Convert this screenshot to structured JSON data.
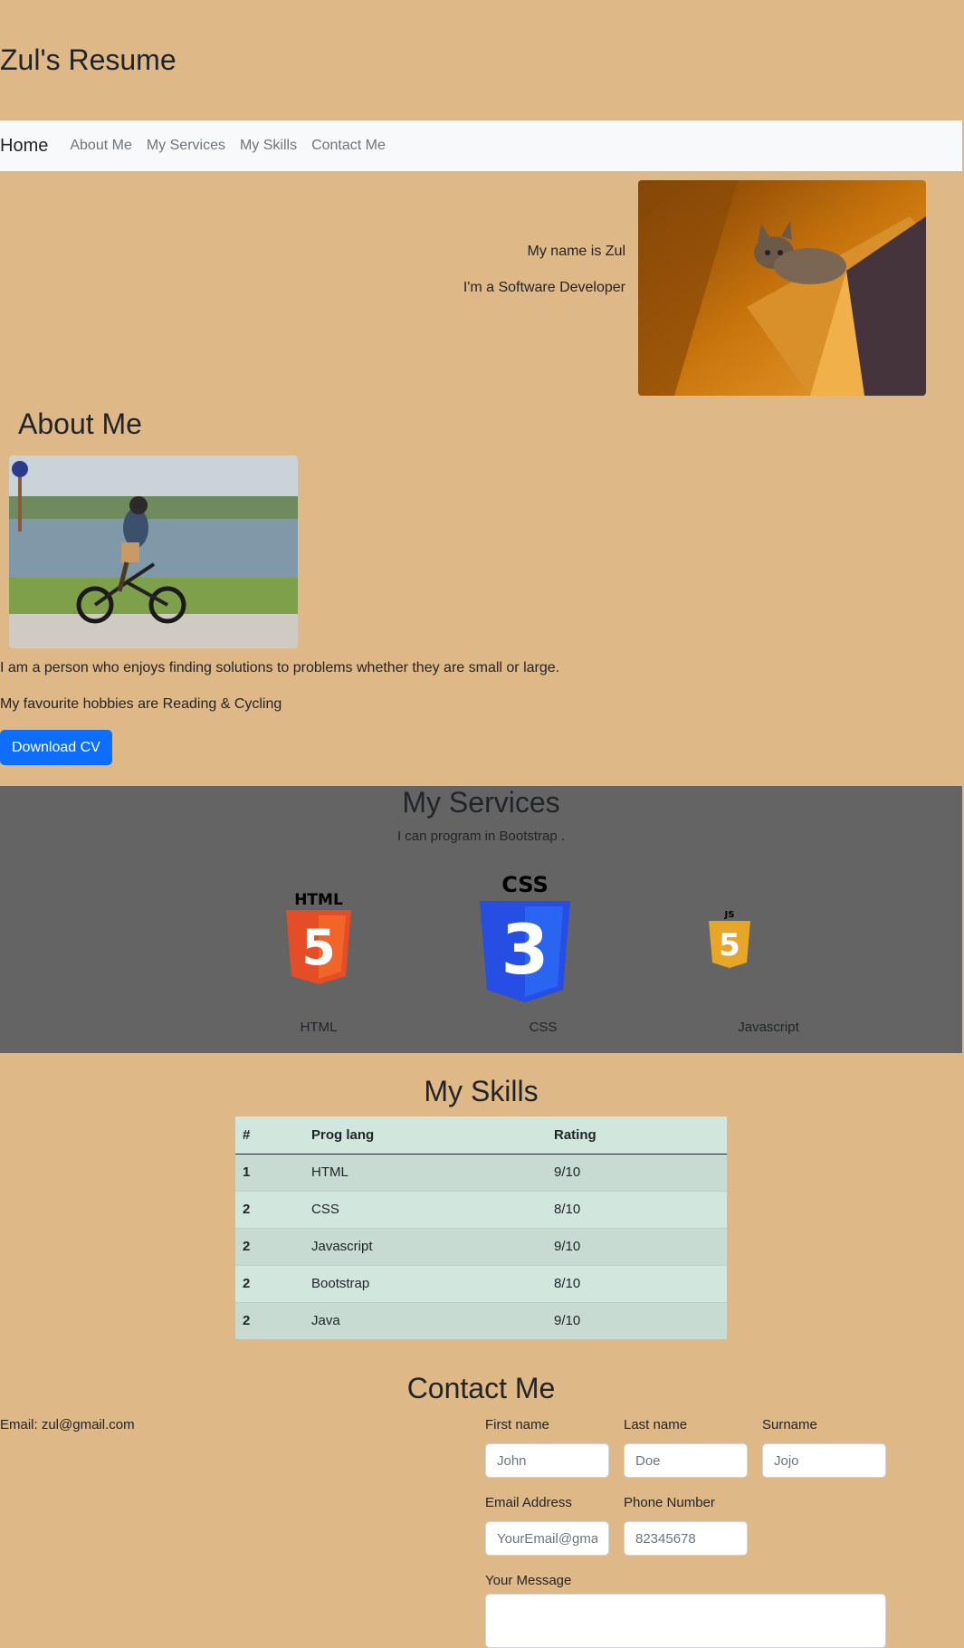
{
  "header": {
    "title": "Zul's Resume"
  },
  "nav": {
    "brand": "Home",
    "links": [
      "About Me",
      "My Services",
      "My Skills",
      "Contact Me"
    ]
  },
  "hero": {
    "line1": "My name is Zul",
    "line2": "I'm a Software Developer",
    "photo": "cat-on-shelf-photo"
  },
  "about": {
    "title": "About Me",
    "photo": "person-cycling-photo",
    "paragraph1": "I am a person who enjoys finding solutions to problems whether they are small or large.",
    "paragraph2": "My favourite hobbies are Reading & Cycling",
    "download_label": "Download CV"
  },
  "services": {
    "title": "My Services",
    "subtitle": "I can program in Bootstrap .",
    "items": [
      {
        "label": "HTML",
        "icon": "html5-icon",
        "icon_text": "HTML",
        "glyph": "5",
        "color": "#e44d26"
      },
      {
        "label": "CSS",
        "icon": "css3-icon",
        "icon_text": "CSS",
        "glyph": "3",
        "color": "#264de4"
      },
      {
        "label": "Javascript",
        "icon": "js-icon",
        "icon_text": "JS",
        "glyph": "5",
        "color": "#e8a628"
      }
    ]
  },
  "skills": {
    "title": "My Skills",
    "headers": [
      "#",
      "Prog lang",
      "Rating"
    ],
    "rows": [
      [
        "1",
        "HTML",
        "9/10"
      ],
      [
        "2",
        "CSS",
        "8/10"
      ],
      [
        "2",
        "Javascript",
        "9/10"
      ],
      [
        "2",
        "Bootstrap",
        "8/10"
      ],
      [
        "2",
        "Java",
        "9/10"
      ]
    ]
  },
  "contact": {
    "title": "Contact Me",
    "email_text": "Email: zul@gmail.com",
    "first_name": {
      "label": "First name",
      "placeholder": "John"
    },
    "last_name": {
      "label": "Last name",
      "placeholder": "Doe"
    },
    "surname": {
      "label": "Surname",
      "placeholder": "Jojo"
    },
    "email_address": {
      "label": "Email Address",
      "placeholder": "YourEmail@gmail.com"
    },
    "phone": {
      "label": "Phone Number",
      "placeholder": "82345678"
    },
    "message": {
      "label": "Your Message"
    }
  },
  "colors": {
    "page_bg": "#deb887",
    "services_bg": "#646464",
    "navbar_bg": "#f8f9fa",
    "primary_button": "#0d6efd",
    "table_bg": "#d1e7dd"
  }
}
